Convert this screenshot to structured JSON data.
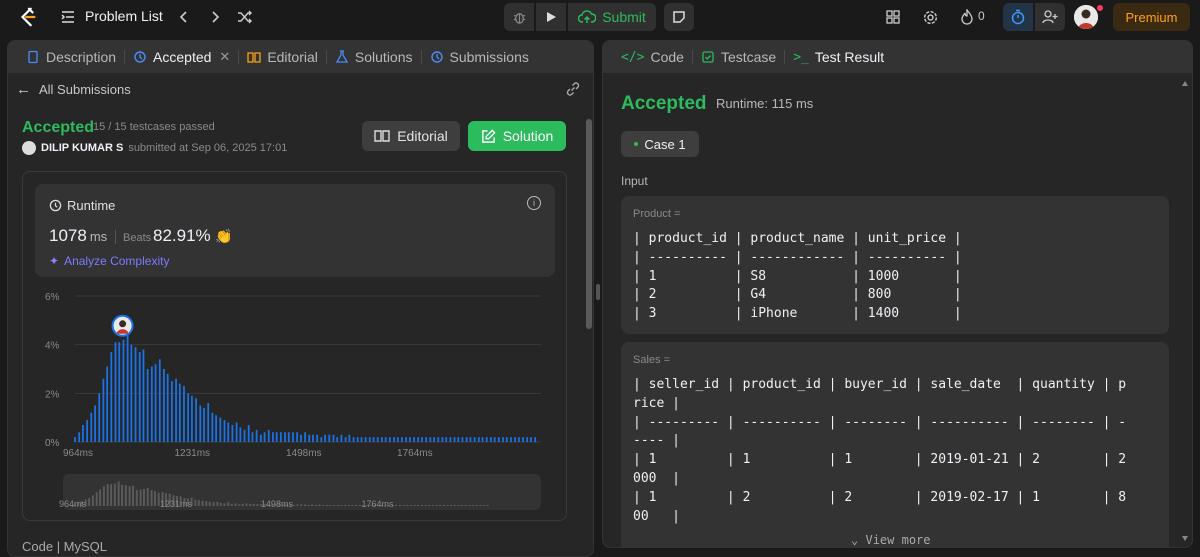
{
  "topbar": {
    "problem_list": "Problem List",
    "submit": "Submit",
    "fire_count": "0",
    "premium": "Premium"
  },
  "left_tabs": [
    {
      "label": "Description"
    },
    {
      "label": "Accepted"
    },
    {
      "label": "Editorial"
    },
    {
      "label": "Solutions"
    },
    {
      "label": "Submissions"
    }
  ],
  "submission": {
    "back_label": "All Submissions",
    "status": "Accepted",
    "testcases": "15 / 15 testcases passed",
    "user": "DILIP KUMAR S",
    "submitted_at": "submitted at Sep 06, 2025 17:01",
    "editorial_btn": "Editorial",
    "solution_btn": "Solution",
    "runtime_label": "Runtime",
    "runtime_value": "1078",
    "runtime_unit": "ms",
    "beats_label": "Beats",
    "beats_value": "82.91%",
    "analyze": "Analyze Complexity",
    "code_lang": "Code | MySQL"
  },
  "chart_data": {
    "type": "bar",
    "ylabel": "",
    "xlabel": "",
    "y_ticks": [
      "6%",
      "4%",
      "2%",
      "0%"
    ],
    "ylim": [
      0,
      6
    ],
    "x_ticks": [
      "964ms",
      "1231ms",
      "1498ms",
      "1764ms"
    ],
    "x_tick_values": [
      964,
      1231,
      1498,
      1764
    ],
    "xlim": [
      964,
      2080
    ],
    "bar_width_ms": 7.7,
    "marker_ms": 1078,
    "x": [
      964,
      974,
      983,
      993,
      1003,
      1012,
      1022,
      1032,
      1041,
      1051,
      1061,
      1070,
      1080,
      1090,
      1099,
      1109,
      1119,
      1128,
      1138,
      1148,
      1157,
      1167,
      1177,
      1186,
      1196,
      1206,
      1215,
      1225,
      1235,
      1244,
      1254,
      1264,
      1273,
      1283,
      1293,
      1302,
      1312,
      1322,
      1331,
      1341,
      1351,
      1360,
      1370,
      1380,
      1389,
      1399,
      1409,
      1418,
      1428,
      1438,
      1447,
      1457,
      1467,
      1476,
      1486,
      1496,
      1505,
      1515,
      1525,
      1534,
      1544,
      1554,
      1563,
      1573,
      1583,
      1592,
      1602,
      1612,
      1621,
      1631,
      1641,
      1650,
      1660,
      1670,
      1679,
      1689,
      1699,
      1708,
      1718,
      1728,
      1737,
      1747,
      1757,
      1766,
      1776,
      1786,
      1795,
      1805,
      1815,
      1824,
      1834,
      1844,
      1853,
      1863,
      1873,
      1882,
      1892,
      1902,
      1911,
      1921,
      1931,
      1940,
      1950,
      1960,
      1969,
      1979,
      1989,
      1998,
      2008,
      2018,
      2027,
      2037,
      2047,
      2056,
      2066
    ],
    "values": [
      0.2,
      0.4,
      0.7,
      0.9,
      1.2,
      1.5,
      2.0,
      2.6,
      3.1,
      3.7,
      4.1,
      4.1,
      4.2,
      4.6,
      4.0,
      3.9,
      3.7,
      3.8,
      3.0,
      3.1,
      3.2,
      3.4,
      3.0,
      2.8,
      2.5,
      2.6,
      2.4,
      2.3,
      2.0,
      1.9,
      1.8,
      1.5,
      1.4,
      1.6,
      1.2,
      1.1,
      1.0,
      0.9,
      0.8,
      0.7,
      0.8,
      0.6,
      0.5,
      0.7,
      0.4,
      0.5,
      0.3,
      0.4,
      0.5,
      0.4,
      0.4,
      0.4,
      0.4,
      0.4,
      0.4,
      0.4,
      0.3,
      0.4,
      0.3,
      0.3,
      0.3,
      0.2,
      0.3,
      0.3,
      0.3,
      0.2,
      0.3,
      0.2,
      0.3,
      0.2,
      0.2,
      0.2,
      0.2,
      0.2,
      0.2,
      0.2,
      0.2,
      0.2,
      0.2,
      0.2,
      0.2,
      0.2,
      0.2,
      0.2,
      0.2,
      0.2,
      0.2,
      0.2,
      0.2,
      0.2,
      0.2,
      0.2,
      0.2,
      0.2,
      0.2,
      0.2,
      0.2,
      0.2,
      0.2,
      0.2,
      0.2,
      0.2,
      0.2,
      0.2,
      0.2,
      0.2,
      0.2,
      0.2,
      0.2,
      0.2,
      0.2,
      0.2,
      0.2,
      0.2,
      0.2
    ],
    "mini_x_ticks": [
      "964ms",
      "1231ms",
      "1498ms",
      "1764ms"
    ]
  },
  "colors": {
    "accent": "#2cbb5d",
    "bar": "#1a73e8",
    "premium": "#ffa116"
  },
  "right_tabs": [
    {
      "label": "Code"
    },
    {
      "label": "Testcase"
    },
    {
      "label": "Test Result"
    }
  ],
  "result": {
    "status": "Accepted",
    "runtime": "Runtime: 115 ms",
    "case": "Case 1",
    "input_label": "Input",
    "product_label": "Product =",
    "product_table": "| product_id | product_name | unit_price |\n| ---------- | ------------ | ---------- |\n| 1          | S8           | 1000       |\n| 2          | G4           | 800        |\n| 3          | iPhone       | 1400       |",
    "sales_label": "Sales =",
    "sales_table": "| seller_id | product_id | buyer_id | sale_date  | quantity | p\nrice |\n| --------- | ---------- | -------- | ---------- | -------- | -\n---- |\n| 1         | 1          | 1        | 2019-01-21 | 2        | 2\n000  |\n| 1         | 2          | 2        | 2019-02-17 | 1        | 8\n00   |",
    "view_more": "View more"
  }
}
